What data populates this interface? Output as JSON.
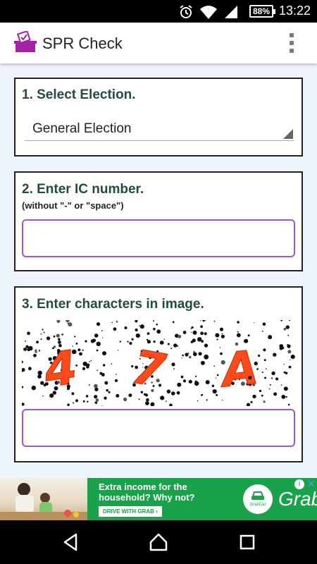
{
  "status_bar": {
    "battery": "88%",
    "time": "13:22"
  },
  "app_bar": {
    "title": "SPR Check"
  },
  "election": {
    "title": "1. Select Election.",
    "selected_value": "General Election"
  },
  "ic": {
    "title": "2. Enter IC number.",
    "hint": "(without \"-\" or \"space\")",
    "value": ""
  },
  "captcha": {
    "title": "3. Enter characters in image.",
    "characters": [
      "4",
      "7",
      "A"
    ],
    "value": ""
  },
  "ad": {
    "headline": "Extra income for the household? Why not?",
    "cta": "DRIVE WITH GRAB ›",
    "circle_label": "GrabCar",
    "logo": "Grab",
    "info": "i",
    "close": "✕"
  },
  "colors": {
    "accent_purple": "#9b59c6",
    "title_teal": "#234a45",
    "content_bg": "#eef4fb",
    "ad_green": "#19a24a",
    "captcha_char": "#ff4a1a"
  }
}
